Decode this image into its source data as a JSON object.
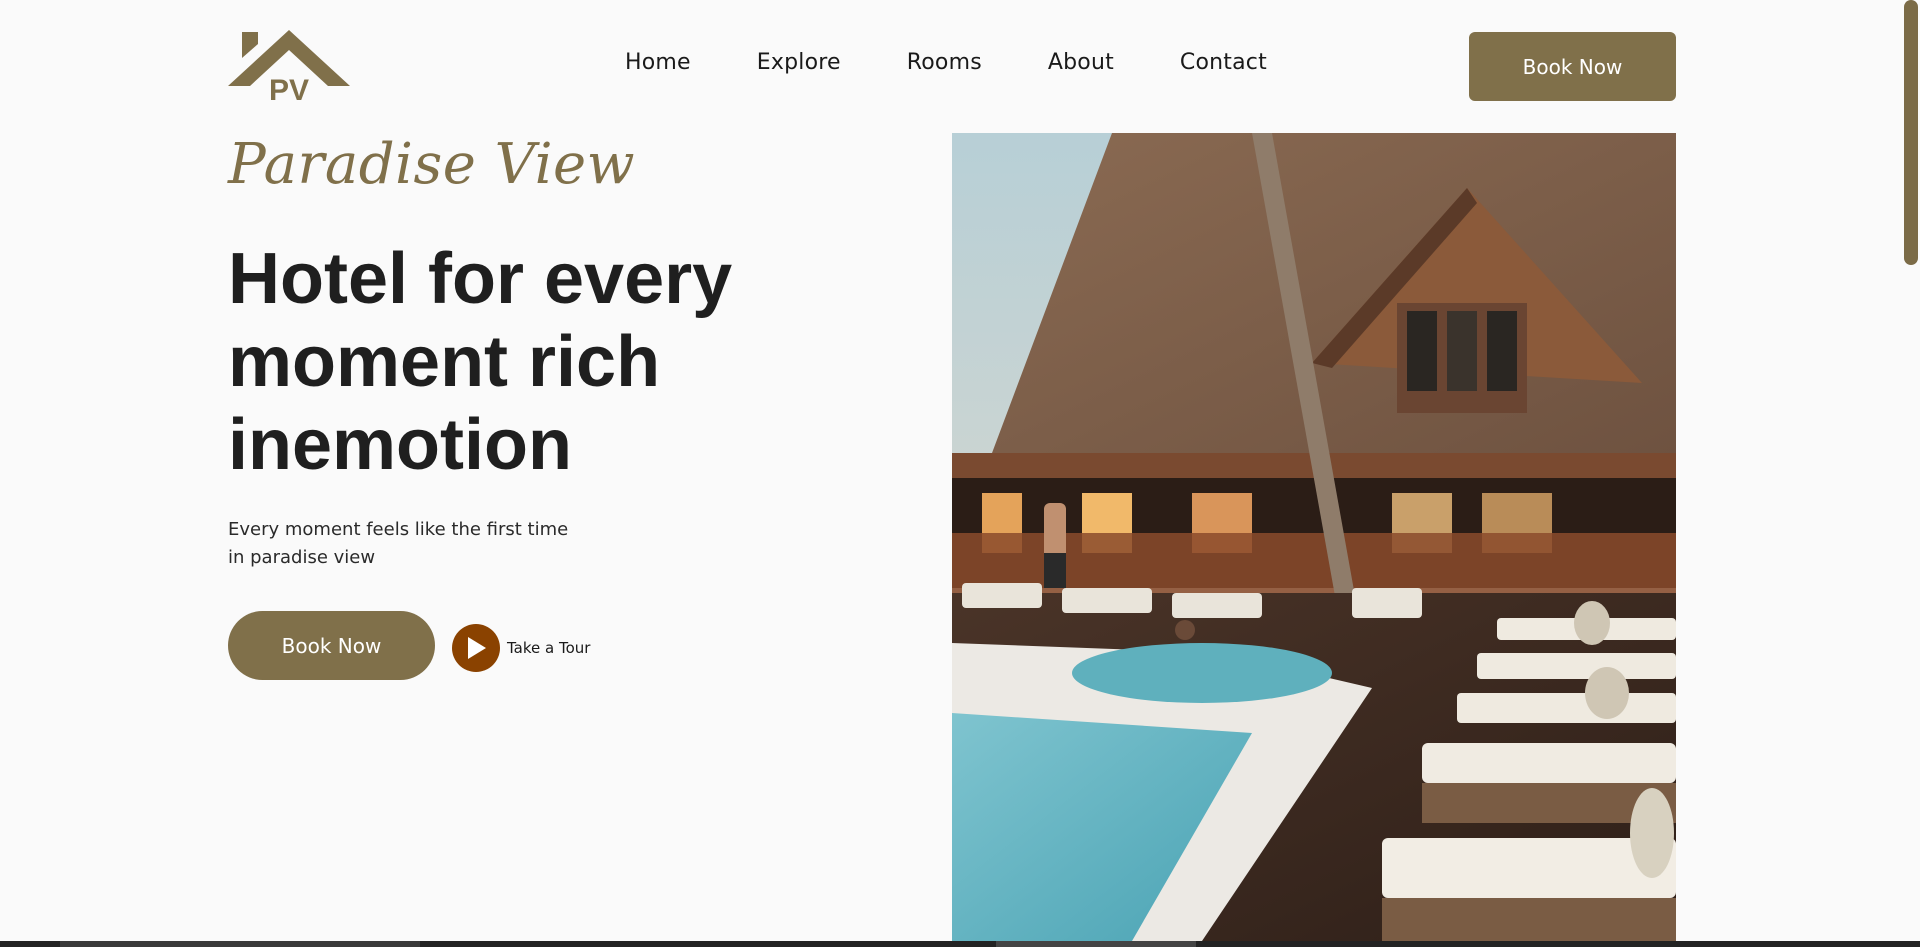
{
  "logo": {
    "text": "PV",
    "icon": "house-roof-logo-icon",
    "color": "#80704a"
  },
  "nav": {
    "items": [
      {
        "label": "Home"
      },
      {
        "label": "Explore"
      },
      {
        "label": "Rooms"
      },
      {
        "label": "About"
      },
      {
        "label": "Contact"
      }
    ]
  },
  "header": {
    "book_label": "Book Now"
  },
  "hero": {
    "brand": "Paradise View",
    "headline": "Hotel for every moment rich inemotion",
    "subtext_line1": "Every moment feels like the first time",
    "subtext_line2": "in paradise view",
    "book_label": "Book Now",
    "tour_label": "Take a Tour",
    "tour_icon": "play-icon"
  },
  "colors": {
    "accent": "#80704a",
    "play_button": "#8a4200",
    "headline": "#1f1f1f",
    "background": "#fafafa"
  }
}
